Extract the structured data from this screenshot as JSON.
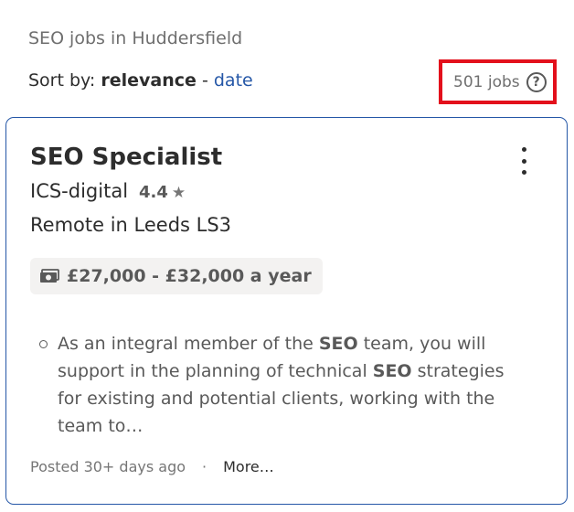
{
  "search": {
    "heading": "SEO jobs in Huddersfield"
  },
  "sort": {
    "label": "Sort by:",
    "active": "relevance",
    "separator": "-",
    "alternate": "date"
  },
  "results": {
    "count_text": "501 jobs",
    "help_icon": "question-circle-icon",
    "help_glyph": "?",
    "highlight_color": "#e3101c"
  },
  "job": {
    "title": "SEO Specialist",
    "company": "ICS-digital",
    "rating": "4.4",
    "rating_icon": "star-icon",
    "rating_glyph": "★",
    "location": "Remote in Leeds LS3",
    "salary": "£27,000 - £32,000 a year",
    "salary_icon": "money-icon",
    "snippet": {
      "part1": "As an integral member of the ",
      "bold1": "SEO",
      "part2": " team, you will support in the planning of technical ",
      "bold2": "SEO",
      "part3": " strategies for existing and potential clients, working with the team to…"
    },
    "posted": "Posted 30+ days ago",
    "dot": "·",
    "more": "More…",
    "menu_icon": "kebab-menu-icon"
  },
  "colors": {
    "link": "#2557a7",
    "card_border": "#2557a7",
    "chip_bg": "#f3f2f1"
  }
}
